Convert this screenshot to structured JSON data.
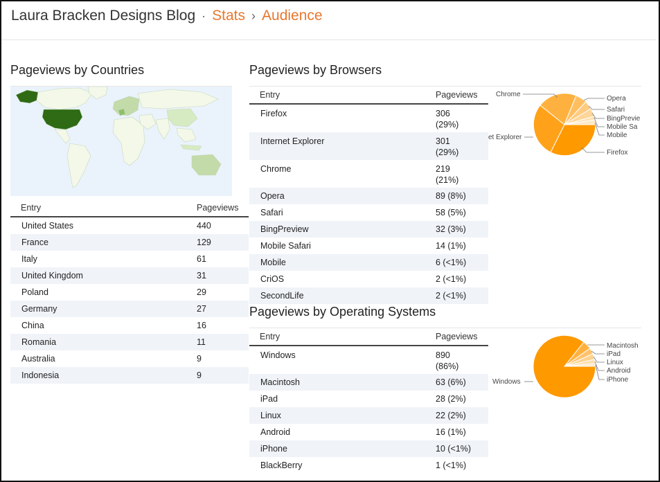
{
  "header": {
    "blog_title": "Laura Bracken Designs Blog",
    "separator": "·",
    "crumb_sep": "›",
    "stats": "Stats",
    "audience": "Audience"
  },
  "colors": {
    "accent": "#e8772e",
    "pie": "#ff9900",
    "map_dark": "#2e6b14"
  },
  "countries": {
    "title": "Pageviews by Countries",
    "col_entry": "Entry",
    "col_pageviews": "Pageviews",
    "rows": [
      {
        "entry": "United States",
        "views": "440"
      },
      {
        "entry": "France",
        "views": "129"
      },
      {
        "entry": "Italy",
        "views": "61"
      },
      {
        "entry": "United Kingdom",
        "views": "31"
      },
      {
        "entry": "Poland",
        "views": "29"
      },
      {
        "entry": "Germany",
        "views": "27"
      },
      {
        "entry": "China",
        "views": "16"
      },
      {
        "entry": "Romania",
        "views": "11"
      },
      {
        "entry": "Australia",
        "views": "9"
      },
      {
        "entry": "Indonesia",
        "views": "9"
      }
    ]
  },
  "browsers": {
    "title": "Pageviews by Browsers",
    "col_entry": "Entry",
    "col_pageviews": "Pageviews",
    "rows": [
      {
        "entry": "Firefox",
        "views": "306",
        "pct": "(29%)"
      },
      {
        "entry": "Internet Explorer",
        "views": "301",
        "pct": "(29%)"
      },
      {
        "entry": "Chrome",
        "views": "219",
        "pct": "(21%)"
      },
      {
        "entry": "Opera",
        "views": "89 (8%)"
      },
      {
        "entry": "Safari",
        "views": "58 (5%)"
      },
      {
        "entry": "BingPreview",
        "views": "32 (3%)"
      },
      {
        "entry": "Mobile Safari",
        "views": "14 (1%)"
      },
      {
        "entry": "Mobile",
        "views": "6 (<1%)"
      },
      {
        "entry": "CriOS",
        "views": "2 (<1%)"
      },
      {
        "entry": "SecondLife",
        "views": "2 (<1%)"
      }
    ],
    "pie_labels": {
      "chrome": "Chrome",
      "opera": "Opera",
      "safari": "Safari",
      "bing": "BingPrevie",
      "msafari": "Mobile Sa",
      "mobile": "Mobile",
      "ie": "et Explorer",
      "firefox": "Firefox"
    }
  },
  "os": {
    "title": "Pageviews by Operating Systems",
    "col_entry": "Entry",
    "col_pageviews": "Pageviews",
    "rows": [
      {
        "entry": "Windows",
        "views": "890",
        "pct": "(86%)"
      },
      {
        "entry": "Macintosh",
        "views": "63 (6%)"
      },
      {
        "entry": "iPad",
        "views": "28 (2%)"
      },
      {
        "entry": "Linux",
        "views": "22 (2%)"
      },
      {
        "entry": "Android",
        "views": "16 (1%)"
      },
      {
        "entry": "iPhone",
        "views": "10 (<1%)"
      },
      {
        "entry": "BlackBerry",
        "views": "1 (<1%)"
      }
    ],
    "pie_labels": {
      "mac": "Macintosh",
      "ipad": "iPad",
      "linux": "Linux",
      "android": "Android",
      "iphone": "iPhone",
      "windows": "Windows"
    }
  }
}
